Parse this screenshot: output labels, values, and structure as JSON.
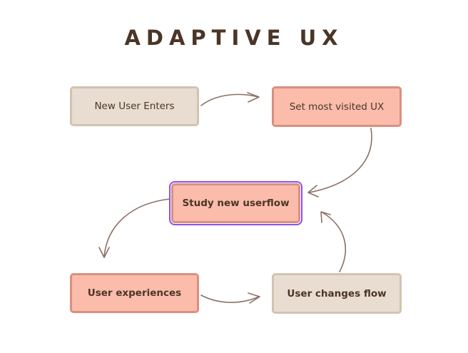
{
  "title": "ADAPTIVE UX",
  "nodes": {
    "new_user_enters": "New User Enters",
    "set_most_visited_ux": "Set most visited UX",
    "study_new_userflow": "Study new userflow",
    "user_experiences": "User experiences",
    "user_changes_flow": "User changes flow"
  },
  "colors": {
    "title": "#4a3526",
    "beige_fill": "#e8ddd0",
    "beige_border": "#d2c3b1",
    "salmon_fill": "#fbbcab",
    "salmon_border": "#d9907f",
    "arrow": "#8a7066",
    "selection": "#8a4ff5"
  }
}
